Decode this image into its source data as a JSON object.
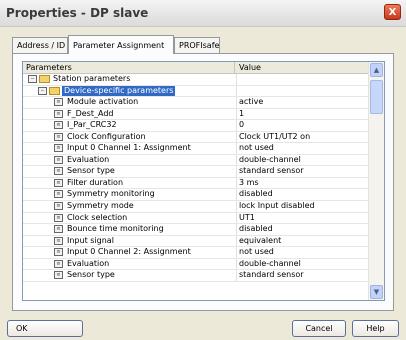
{
  "window": {
    "title": "Properties - DP slave",
    "close_label": "X"
  },
  "tabs": [
    {
      "label": "Address / ID"
    },
    {
      "label": "Parameter Assignment"
    },
    {
      "label": "PROFIsafe"
    }
  ],
  "table": {
    "headers": {
      "parameters": "Parameters",
      "value": "Value"
    },
    "station": "Station parameters",
    "device": "Device-specific parameters",
    "rows": [
      {
        "name": "Module activation",
        "value": "active"
      },
      {
        "name": "F_Dest_Add",
        "value": "1"
      },
      {
        "name": "I_Par_CRC32",
        "value": "0"
      },
      {
        "name": "Clock Configuration",
        "value": "Clock UT1/UT2 on"
      },
      {
        "name": "Input 0 Channel 1: Assignment",
        "value": "not used"
      },
      {
        "name": "Evaluation",
        "value": "double-channel"
      },
      {
        "name": "Sensor type",
        "value": "standard sensor"
      },
      {
        "name": "Filter duration",
        "value": "3 ms"
      },
      {
        "name": "Symmetry monitoring",
        "value": "disabled"
      },
      {
        "name": "Symmetry mode",
        "value": "lock Input disabled"
      },
      {
        "name": "Clock selection",
        "value": "UT1"
      },
      {
        "name": "Bounce time monitoring",
        "value": "disabled"
      },
      {
        "name": "Input signal",
        "value": "equivalent"
      },
      {
        "name": "Input 0 Channel 2: Assignment",
        "value": "not used"
      },
      {
        "name": "Evaluation",
        "value": "double-channel"
      },
      {
        "name": "Sensor type",
        "value": "standard sensor"
      }
    ]
  },
  "buttons": {
    "ok": "OK",
    "cancel": "Cancel",
    "help": "Help"
  }
}
